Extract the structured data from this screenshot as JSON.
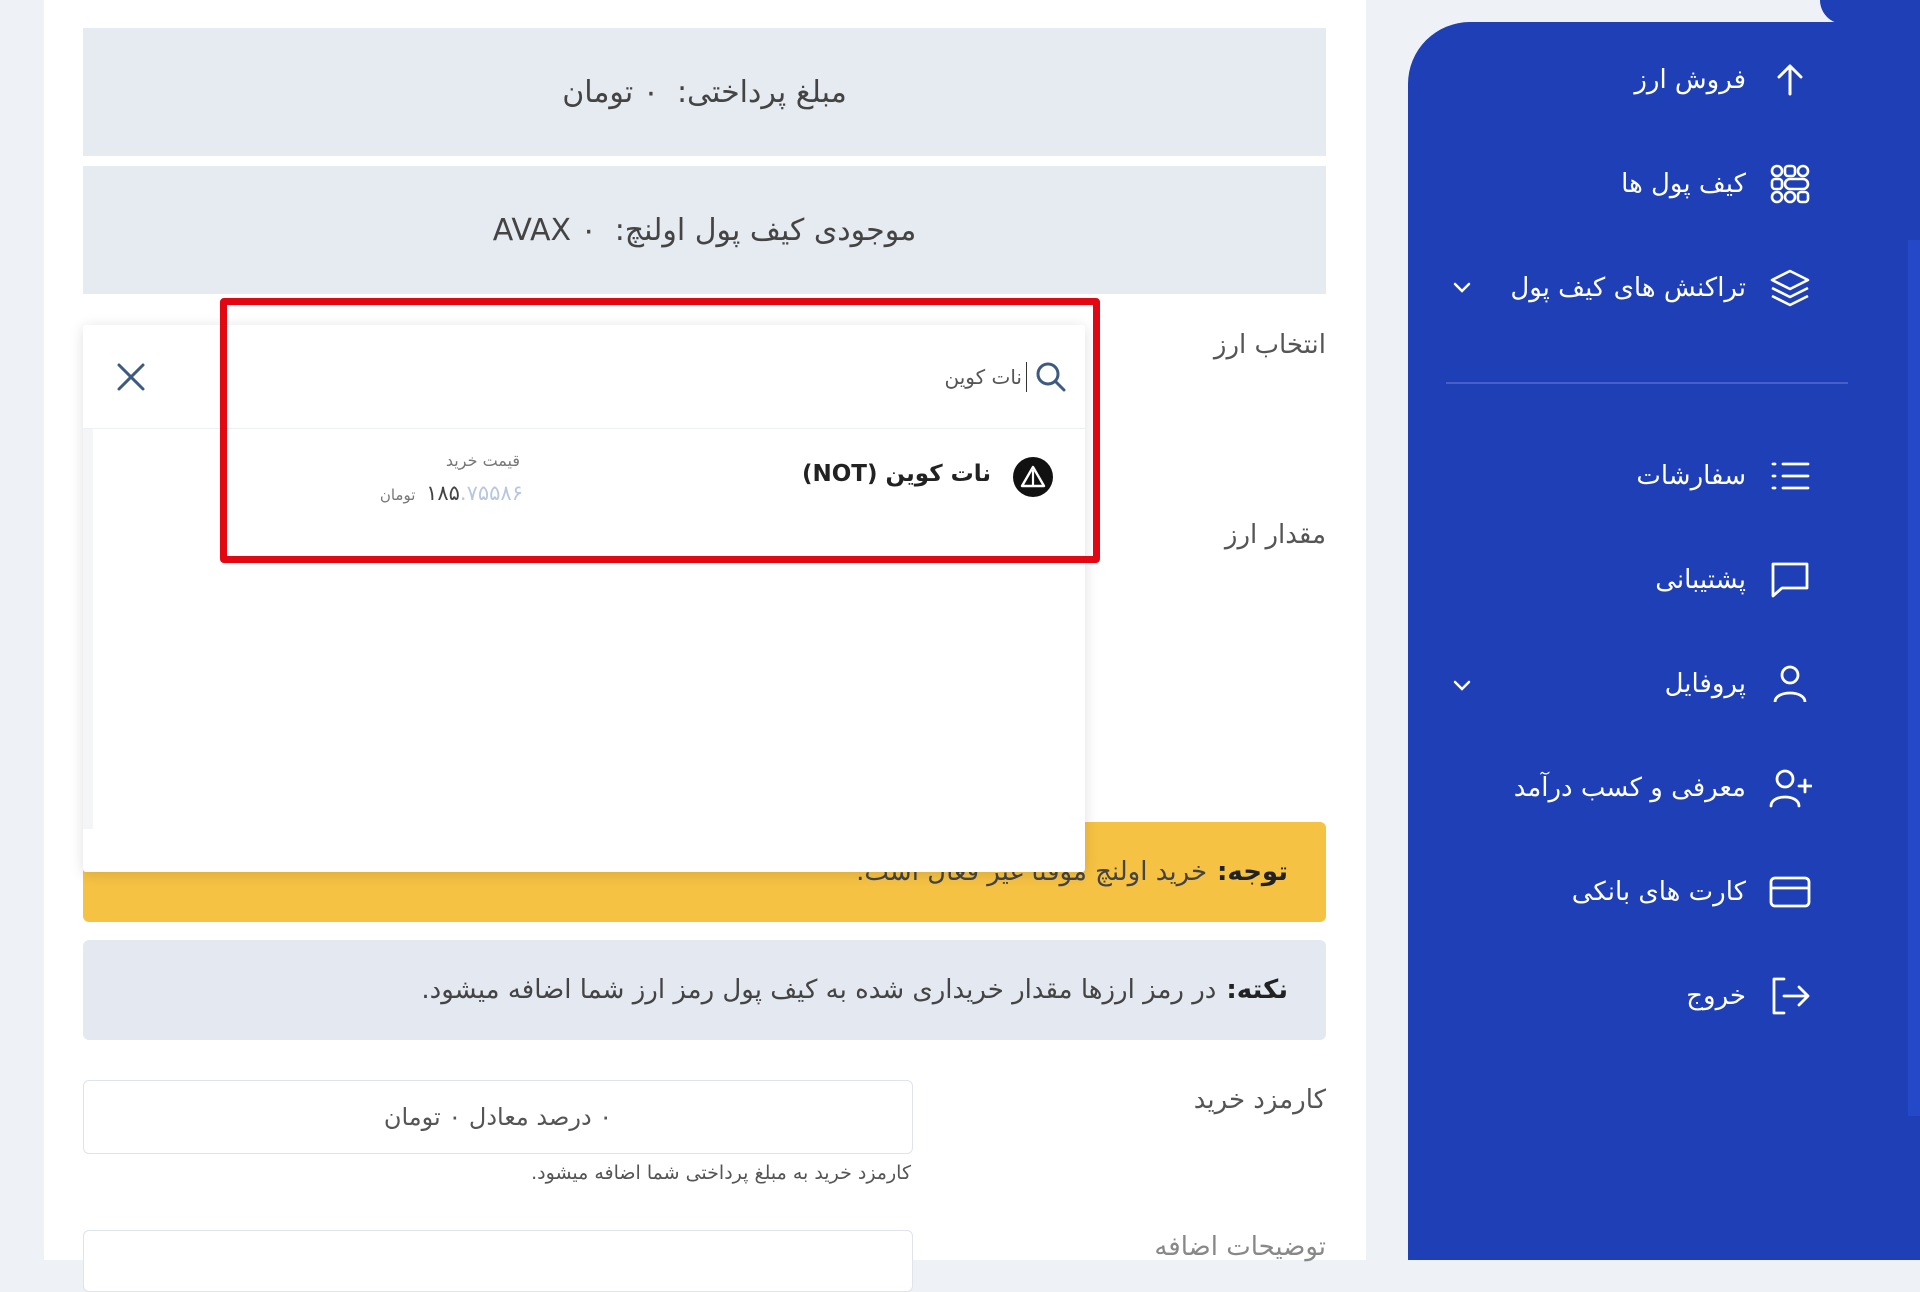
{
  "payment": {
    "label": "مبلغ پرداختی:",
    "value": "۰ تومان"
  },
  "balance": {
    "label": "موجودی کیف پول اولنچ:",
    "value": "۰ AVAX"
  },
  "form": {
    "select_currency_label": "انتخاب ارز",
    "amount_label": "مقدار ارز",
    "fee_label": "کارمزد خرید",
    "fee_value": "۰ درصد معادل ۰ تومان",
    "fee_hint": "کارمزد خرید به مبلغ پرداختی شما اضافه میشود.",
    "description_label": "توضیحات اضافه"
  },
  "dropdown": {
    "search_value": "نات کوین",
    "search_placeholder": "جستجو",
    "result": {
      "name": "نات کوین (NOT)",
      "price_label": "قیمت خرید",
      "price_int": "۱۸۵",
      "price_frac": ".۷۵۵۸۶",
      "price_unit": "تومان"
    }
  },
  "warning": {
    "title": "توجه:",
    "text": "خرید اولنچ موقتا غیر فعال است."
  },
  "note": {
    "title": "نکته:",
    "text": "در رمز ارزها مقدار خریداری شده به کیف پول رمز ارز شما اضافه میشود."
  },
  "sidebar": {
    "items": [
      {
        "label": "فروش ارز",
        "icon": "arrow-up-icon"
      },
      {
        "label": "کیف پول ها",
        "icon": "wallet-grid-icon"
      },
      {
        "label": "تراکنش های کیف پول",
        "icon": "layers-icon"
      },
      {
        "label": "سفارشات",
        "icon": "list-icon"
      },
      {
        "label": "پشتیبانی",
        "icon": "chat-icon"
      },
      {
        "label": "پروفایل",
        "icon": "user-icon"
      },
      {
        "label": "معرفی و کسب درآمد",
        "icon": "user-plus-icon"
      },
      {
        "label": "کارت های بانکی",
        "icon": "card-icon"
      },
      {
        "label": "خروج",
        "icon": "logout-icon"
      }
    ]
  },
  "colors": {
    "sidebar": "#1e3fb5",
    "warning": "#f6c244",
    "note": "#e3e8f1",
    "highlight": "#e30613"
  }
}
